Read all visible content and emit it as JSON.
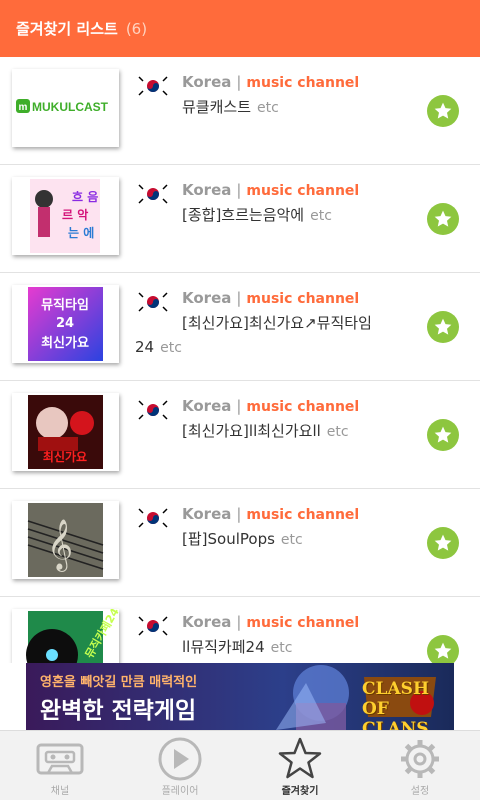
{
  "header": {
    "title": "즐겨찾기 리스트",
    "count": "(6)"
  },
  "items": [
    {
      "country": "Korea",
      "category": "music channel",
      "name": "뮤클캐스트",
      "suffix": "etc",
      "thumb_text": "MUKULCAST"
    },
    {
      "country": "Korea",
      "category": "music channel",
      "name": "[종합]흐르는음악에",
      "suffix": "etc",
      "thumb_text": "흐음르악는에"
    },
    {
      "country": "Korea",
      "category": "music channel",
      "name": "[최신가요]최신가요↗뮤직타임24",
      "suffix": "etc",
      "thumb_text": "뮤직타임24최신가요"
    },
    {
      "country": "Korea",
      "category": "music channel",
      "name": "[최신가요]ll최신가요ll",
      "suffix": "etc",
      "thumb_text": "최신가요"
    },
    {
      "country": "Korea",
      "category": "music channel",
      "name": "[팝]SoulPops",
      "suffix": "etc",
      "thumb_text": ""
    },
    {
      "country": "Korea",
      "category": "music channel",
      "name": "ll뮤직카페24",
      "suffix": "etc",
      "thumb_text": "뮤직카페24"
    }
  ],
  "ad": {
    "line1": "영혼을 빼앗길 만큼 매력적인",
    "line2": "완벽한 전략게임",
    "brand": "CLASH OF CLANS"
  },
  "tabs": [
    {
      "label": "채널",
      "icon": "cassette-icon",
      "active": false
    },
    {
      "label": "플레이어",
      "icon": "play-icon",
      "active": false
    },
    {
      "label": "즐겨찾기",
      "icon": "star-icon",
      "active": true
    },
    {
      "label": "설정",
      "icon": "gear-icon",
      "active": false
    }
  ],
  "colors": {
    "accent": "#ff6b3b",
    "favorite": "#8dc63f",
    "tabbar": "#f2f2f2"
  }
}
